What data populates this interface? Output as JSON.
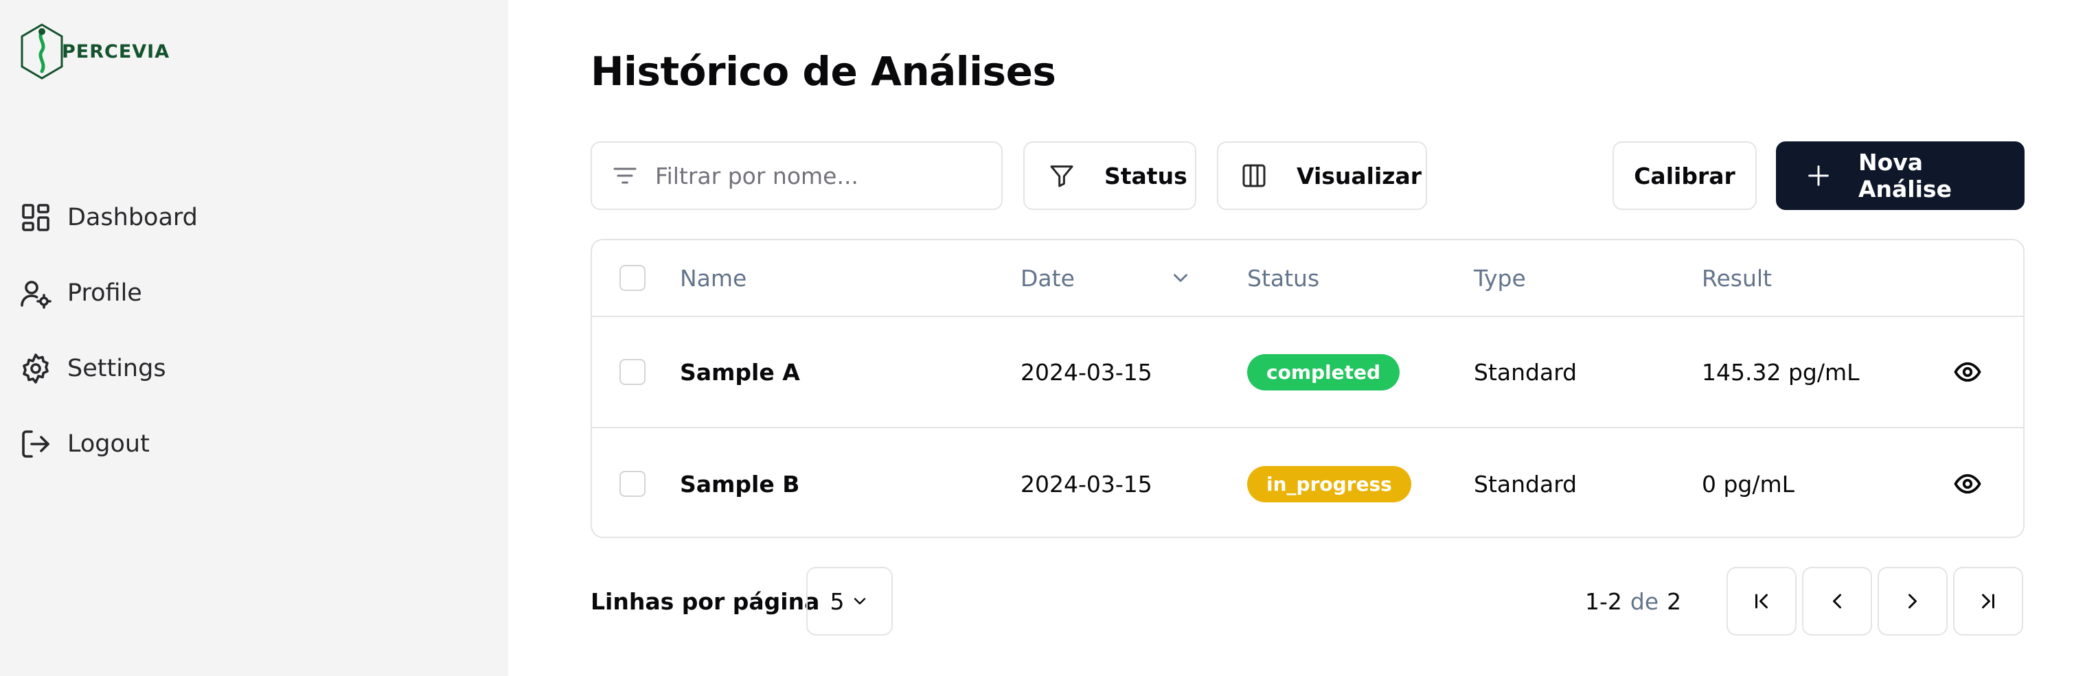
{
  "brand": {
    "name": "PERCEVIA",
    "color": "#14532d"
  },
  "sidebar": {
    "items": [
      {
        "label": "Dashboard",
        "icon": "dashboard-grid-icon"
      },
      {
        "label": "Profile",
        "icon": "user-settings-icon"
      },
      {
        "label": "Settings",
        "icon": "gear-icon"
      },
      {
        "label": "Logout",
        "icon": "logout-icon"
      }
    ]
  },
  "main": {
    "title": "Histórico de Análises",
    "toolbar": {
      "search_placeholder": "Filtrar por nome...",
      "search_value": "",
      "status_label": "Status",
      "view_label": "Visualizar",
      "calibrate_label": "Calibrar",
      "new_label": "Nova Análise"
    },
    "table": {
      "columns": [
        "Name",
        "Date",
        "Status",
        "Type",
        "Result"
      ],
      "rows": [
        {
          "name": "Sample A",
          "date": "2024-03-15",
          "status": "completed",
          "status_color": "#22c55e",
          "type": "Standard",
          "result": "145.32 pg/mL"
        },
        {
          "name": "Sample B",
          "date": "2024-03-15",
          "status": "in_progress",
          "status_color": "#eab308",
          "type": "Standard",
          "result": "0 pg/mL"
        }
      ]
    },
    "pagination": {
      "rows_label": "Linhas por página",
      "rows_per_page": "5",
      "range": "1-2",
      "of_label": "de",
      "total": "2"
    }
  },
  "colors": {
    "primary": "#0f172a",
    "border": "#e4e4e7",
    "muted": "#64748b",
    "sidebar_bg": "#f4f4f5"
  }
}
